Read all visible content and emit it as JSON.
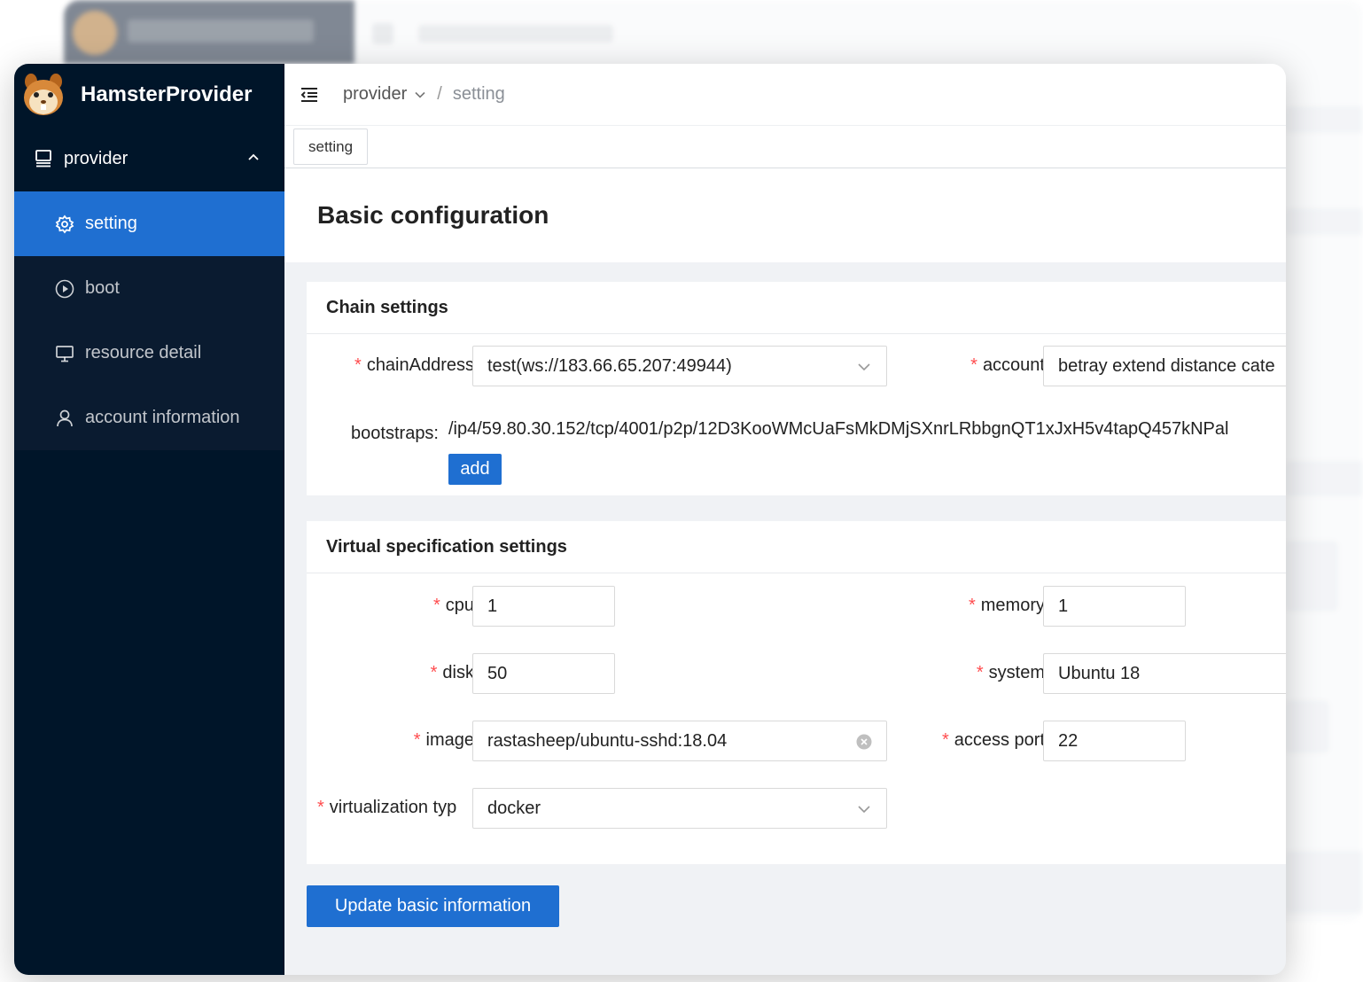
{
  "app": {
    "name": "HamsterProvider",
    "logo_icon": "hamster-logo-icon"
  },
  "sidebar": {
    "group": {
      "label": "provider",
      "icon": "server-icon",
      "expanded": true
    },
    "items": [
      {
        "label": "setting",
        "icon": "gear-icon",
        "active": true
      },
      {
        "label": "boot",
        "icon": "play-circle-icon",
        "active": false
      },
      {
        "label": "resource detail",
        "icon": "monitor-icon",
        "active": false
      },
      {
        "label": "account information",
        "icon": "user-icon",
        "active": false
      }
    ]
  },
  "header": {
    "breadcrumb": {
      "parent": "provider",
      "separator": "/",
      "current": "setting"
    }
  },
  "tabs": [
    {
      "label": "setting"
    }
  ],
  "page": {
    "title": "Basic configuration"
  },
  "chain_settings": {
    "title": "Chain settings",
    "chain_address": {
      "label": "chainAddress",
      "value": "test(ws://183.66.65.207:49944)"
    },
    "account": {
      "label": "account",
      "value": "betray extend distance cate"
    },
    "bootstraps": {
      "label": "bootstraps:",
      "value": "/ip4/59.80.30.152/tcp/4001/p2p/12D3KooWMcUaFsMkDMjSXnrLRbbgnQT1xJxH5v4tapQ457kNPal"
    },
    "add_label": "add"
  },
  "virtual_settings": {
    "title": "Virtual specification settings",
    "cpu": {
      "label": "cpu",
      "value": "1"
    },
    "memory": {
      "label": "memory",
      "value": "1"
    },
    "disk": {
      "label": "disk",
      "value": "50"
    },
    "system": {
      "label": "system",
      "value": "Ubuntu 18"
    },
    "image": {
      "label": "image",
      "value": "rastasheep/ubuntu-sshd:18.04"
    },
    "access_port": {
      "label": "access port",
      "value": "22"
    },
    "virtualization_type": {
      "label": "virtualization typ",
      "value": "docker"
    }
  },
  "actions": {
    "update_label": "Update basic information"
  },
  "colors": {
    "sidebar_bg": "#001529",
    "primary": "#1f6fd1",
    "required": "#ff4d4f"
  }
}
